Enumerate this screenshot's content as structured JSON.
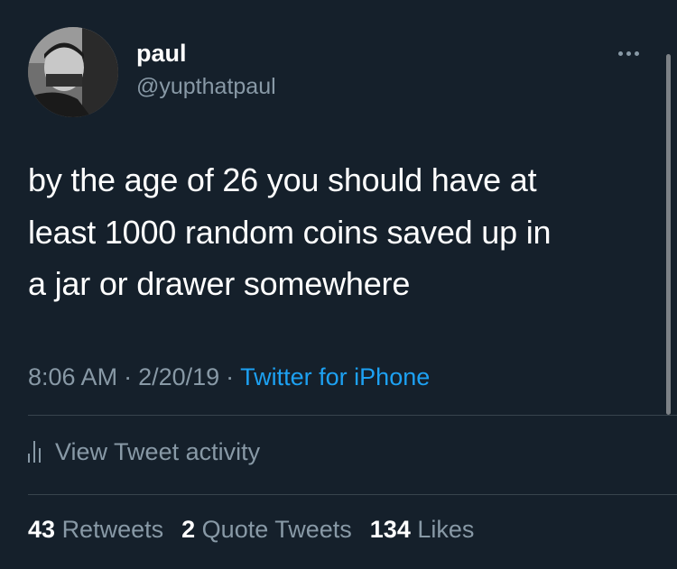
{
  "author": {
    "display_name": "paul",
    "handle": "@yupthatpaul",
    "avatar_icon": "profile-photo"
  },
  "more_icon": "ellipsis-icon",
  "tweet": {
    "lines": [
      "by the age of 26 you should have at",
      "least 1000 random coins saved up in",
      "a jar or drawer somewhere"
    ]
  },
  "meta": {
    "time": "8:06 AM",
    "separator": "·",
    "date": "2/20/19",
    "source": "Twitter for iPhone"
  },
  "activity": {
    "icon": "bar-chart-icon",
    "label": "View Tweet activity"
  },
  "stats": {
    "retweets_count": "43",
    "retweets_label": "Retweets",
    "quotes_count": "2",
    "quotes_label": "Quote Tweets",
    "likes_count": "134",
    "likes_label": "Likes"
  },
  "colors": {
    "background": "#15202b",
    "text_primary": "#ffffff",
    "text_secondary": "#8899a6",
    "link": "#1da1f2",
    "divider": "#38444d"
  }
}
